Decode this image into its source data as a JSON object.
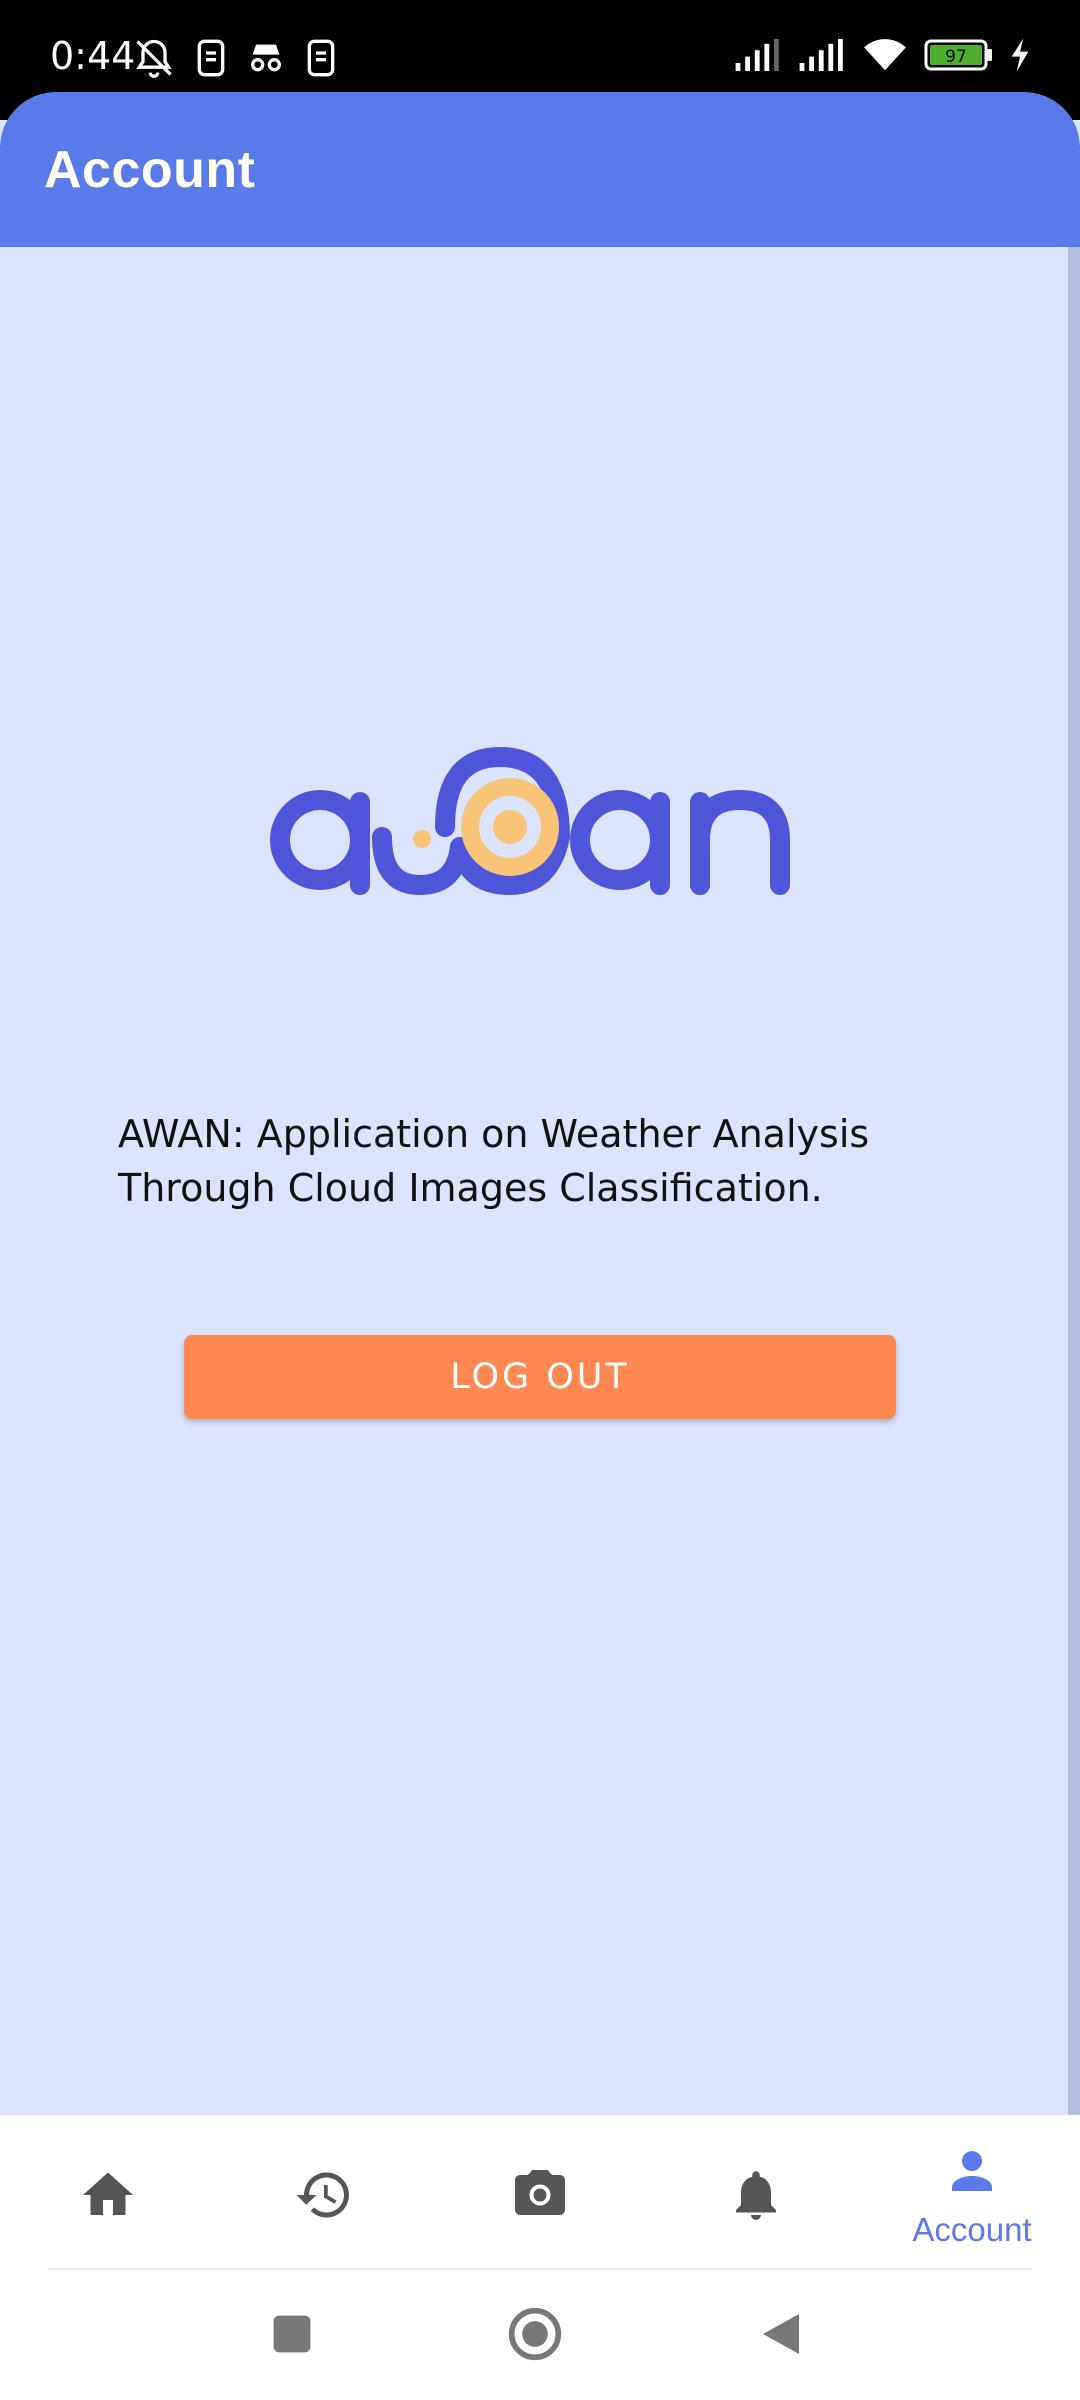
{
  "status_bar": {
    "time": "0:44",
    "battery": "97"
  },
  "app_bar": {
    "title": "Account"
  },
  "logo": {
    "text": "awan",
    "colors": {
      "primary": "#4f55d8",
      "accent": "#f8c478"
    }
  },
  "description": "AWAN: Application on Weather Analysis Through Cloud Images Classification.",
  "logout_button": {
    "label": "LOG OUT"
  },
  "bottom_nav": {
    "items": [
      {
        "icon": "home-icon",
        "label": ""
      },
      {
        "icon": "history-icon",
        "label": ""
      },
      {
        "icon": "camera-icon",
        "label": ""
      },
      {
        "icon": "bell-icon",
        "label": ""
      },
      {
        "icon": "person-icon",
        "label": "Account"
      }
    ]
  },
  "colors": {
    "app_bar": "#5a7aea",
    "background": "#dce3fd",
    "button": "#ff8850",
    "nav_active": "#5a7aea",
    "nav_inactive": "#555555"
  }
}
